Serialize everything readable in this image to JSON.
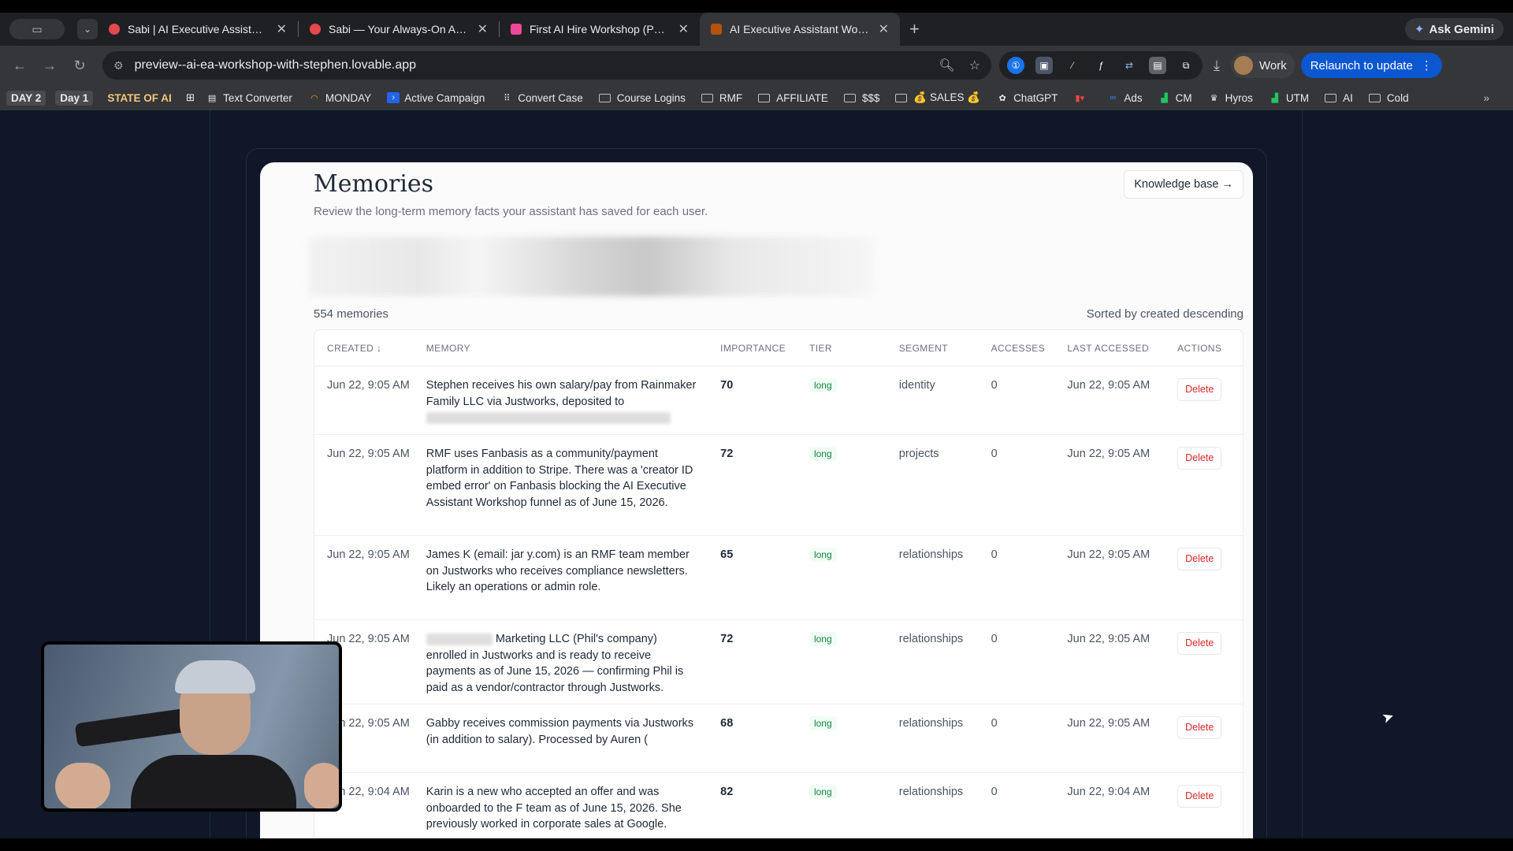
{
  "browser": {
    "tabs": [
      {
        "title": "Sabi | AI Executive Assistant f",
        "favicon_color": "#e5484d",
        "active": false
      },
      {
        "title": "Sabi — Your Always-On AI As",
        "favicon_color": "#e5484d",
        "active": false
      },
      {
        "title": "First AI Hire Workshop (Public",
        "favicon_color": "#ec4899",
        "active": false
      },
      {
        "title": "AI Executive Assistant Works",
        "favicon_color": "#b45309",
        "active": true
      }
    ],
    "new_tab": "+",
    "ask_gemini": "Ask Gemini",
    "url": "preview--ai-ea-workshop-with-stephen.lovable.app",
    "profile": "Work",
    "relaunch": "Relaunch to update"
  },
  "bookmarks": {
    "tags": [
      "DAY 2",
      "Day 1",
      "STATE OF AI"
    ],
    "items": [
      "Text Converter",
      "MONDAY",
      "Active Campaign",
      "Convert Case",
      "Course Logins",
      "RMF",
      "AFFILIATE",
      "$$$",
      "💰 SALES 💰",
      "ChatGPT",
      "Ads",
      "CM",
      "Hyros",
      "UTM",
      "AI",
      "Cold"
    ]
  },
  "page": {
    "title": "Memories",
    "subtitle": "Review the long-term memory facts your assistant has saved for each user.",
    "knowledge_base_button": "Knowledge base →",
    "count": "554 memories",
    "sorted": "Sorted by created descending",
    "columns": {
      "created": "CREATED ↓",
      "memory": "MEMORY",
      "importance": "IMPORTANCE",
      "tier": "TIER",
      "segment": "SEGMENT",
      "accesses": "ACCESSES",
      "last_accessed": "LAST ACCESSED",
      "actions": "ACTIONS"
    },
    "rows": [
      {
        "created": "Jun 22, 9:05 AM",
        "memory": "Stephen receives his own salary/pay from Rainmaker Family LLC via Justworks, deposited to",
        "importance": "70",
        "tier": "long",
        "segment": "identity",
        "accesses": "0",
        "last_accessed": "Jun 22, 9:05 AM",
        "action": "Delete"
      },
      {
        "created": "Jun 22, 9:05 AM",
        "memory": "RMF uses Fanbasis as a community/payment platform in addition to Stripe. There was a 'creator ID embed error' on Fanbasis blocking the AI Executive Assistant Workshop funnel as of June 15, 2026.",
        "importance": "72",
        "tier": "long",
        "segment": "projects",
        "accesses": "0",
        "last_accessed": "Jun 22, 9:05 AM",
        "action": "Delete"
      },
      {
        "created": "Jun 22, 9:05 AM",
        "memory": "James K (email: jar                    y.com) is an RMF team member on Justworks who receives compliance newsletters. Likely an operations or admin role.",
        "importance": "65",
        "tier": "long",
        "segment": "relationships",
        "accesses": "0",
        "last_accessed": "Jun 22, 9:05 AM",
        "action": "Delete"
      },
      {
        "created": "Jun 22, 9:05 AM",
        "memory": "Marketing LLC (Phil's company) enrolled in Justworks and is ready to receive payments as of June 15, 2026 — confirming Phil is paid as a vendor/contractor through Justworks.",
        "importance": "72",
        "tier": "long",
        "segment": "relationships",
        "accesses": "0",
        "last_accessed": "Jun 22, 9:05 AM",
        "action": "Delete"
      },
      {
        "created": "Jun 22, 9:05 AM",
        "memory": "Gabby          receives commission payments via Justworks (in addition to salary). Processed by Auren (",
        "importance": "68",
        "tier": "long",
        "segment": "relationships",
        "accesses": "0",
        "last_accessed": "Jun 22, 9:05 AM",
        "action": "Delete"
      },
      {
        "created": "Jun 22, 9:04 AM",
        "memory": "Karin is a new          who accepted an offer and was onboarded to the F            team as of June 15, 2026. She previously worked in corporate sales at Google.",
        "importance": "82",
        "tier": "long",
        "segment": "relationships",
        "accesses": "0",
        "last_accessed": "Jun 22, 9:04 AM",
        "action": "Delete"
      }
    ]
  }
}
